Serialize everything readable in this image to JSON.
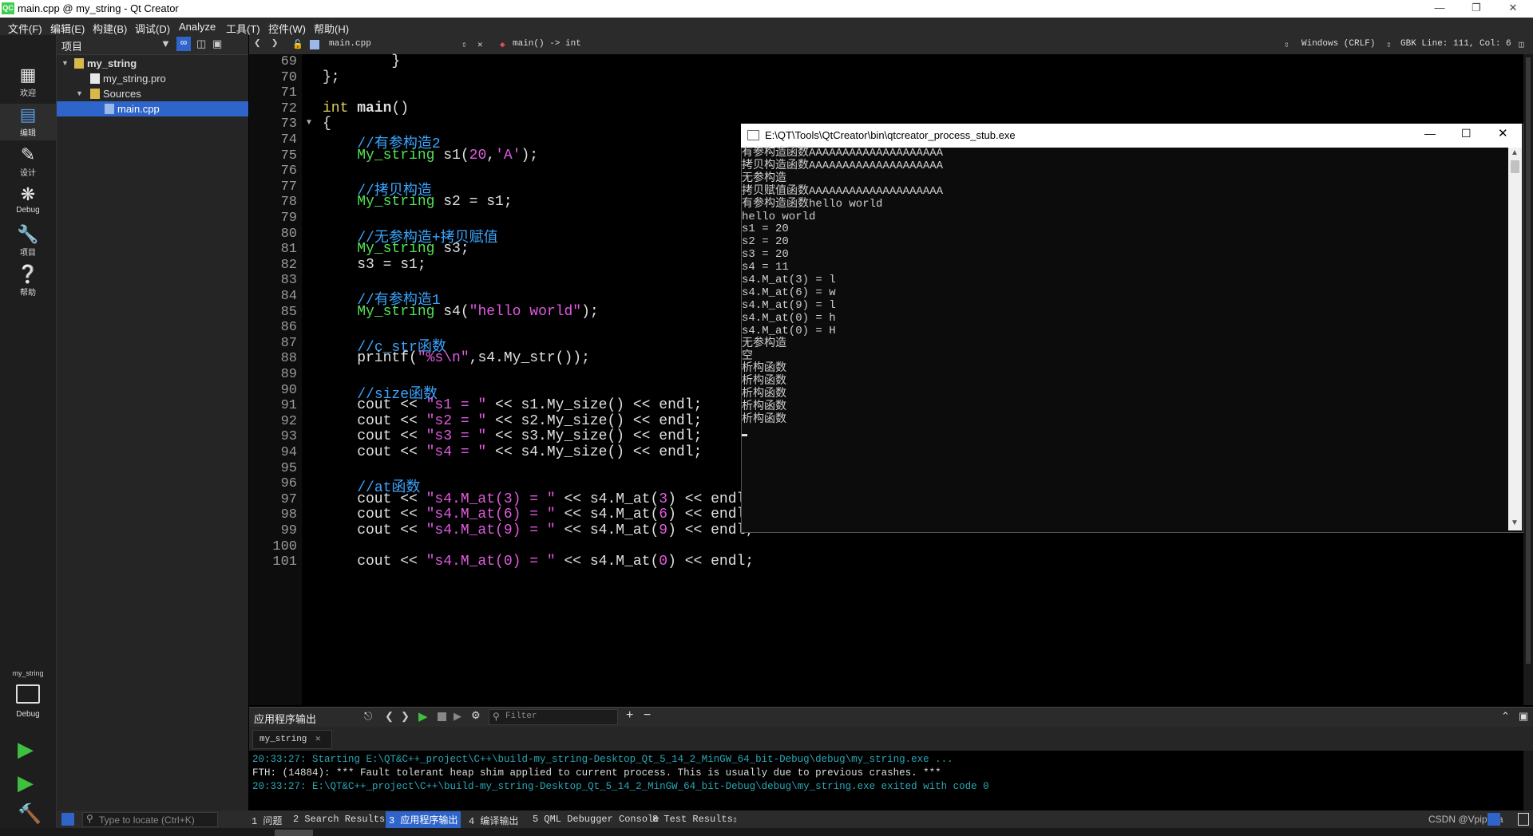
{
  "window": {
    "title": "main.cpp @ my_string - Qt Creator",
    "logo": "QC"
  },
  "menu": [
    "文件(F)",
    "编辑(E)",
    "构建(B)",
    "调试(D)",
    "Analyze",
    "工具(T)",
    "控件(W)",
    "帮助(H)"
  ],
  "modes": [
    {
      "label": "欢迎",
      "icon": "grid-icon"
    },
    {
      "label": "编辑",
      "icon": "edit-icon"
    },
    {
      "label": "设计",
      "icon": "pen-icon"
    },
    {
      "label": "Debug",
      "icon": "bug-icon"
    },
    {
      "label": "项目",
      "icon": "wrench-icon"
    },
    {
      "label": "帮助",
      "icon": "help-icon"
    }
  ],
  "kit": {
    "project": "my_string",
    "config": "Debug"
  },
  "project_panel": {
    "title": "项目",
    "tree": [
      {
        "label": "my_string",
        "level": 0
      },
      {
        "label": "my_string.pro",
        "level": 1
      },
      {
        "label": "Sources",
        "level": 1
      },
      {
        "label": "main.cpp",
        "level": 2
      }
    ]
  },
  "editor_toolbar": {
    "file": "main.cpp",
    "symbol": "main() -> int",
    "line_ending": "Windows (CRLF)",
    "status": "GBK Line: 111, Col: 6"
  },
  "code_lines": [
    {
      "n": "69",
      "t": "        }"
    },
    {
      "n": "70",
      "t": "};"
    },
    {
      "n": "71",
      "t": ""
    },
    {
      "n": "72",
      "t": "int main()"
    },
    {
      "n": "73",
      "t": "{"
    },
    {
      "n": "74",
      "t": "    //有参构造2"
    },
    {
      "n": "75",
      "t": "    My_string s1(20,'A');"
    },
    {
      "n": "76",
      "t": ""
    },
    {
      "n": "77",
      "t": "    //拷贝构造"
    },
    {
      "n": "78",
      "t": "    My_string s2 = s1;"
    },
    {
      "n": "79",
      "t": ""
    },
    {
      "n": "80",
      "t": "    //无参构造+拷贝赋值"
    },
    {
      "n": "81",
      "t": "    My_string s3;"
    },
    {
      "n": "82",
      "t": "    s3 = s1;"
    },
    {
      "n": "83",
      "t": ""
    },
    {
      "n": "84",
      "t": "    //有参构造1"
    },
    {
      "n": "85",
      "t": "    My_string s4(\"hello world\");"
    },
    {
      "n": "86",
      "t": ""
    },
    {
      "n": "87",
      "t": "    //c_str函数"
    },
    {
      "n": "88",
      "t": "    printf(\"%s\\n\",s4.My_str());"
    },
    {
      "n": "89",
      "t": ""
    },
    {
      "n": "90",
      "t": "    //size函数"
    },
    {
      "n": "91",
      "t": "    cout << \"s1 = \" << s1.My_size() << endl;"
    },
    {
      "n": "92",
      "t": "    cout << \"s2 = \" << s2.My_size() << endl;"
    },
    {
      "n": "93",
      "t": "    cout << \"s3 = \" << s3.My_size() << endl;"
    },
    {
      "n": "94",
      "t": "    cout << \"s4 = \" << s4.My_size() << endl;"
    },
    {
      "n": "95",
      "t": ""
    },
    {
      "n": "96",
      "t": "    //at函数"
    },
    {
      "n": "97",
      "t": "    cout << \"s4.M_at(3) = \" << s4.M_at(3) << endl;"
    },
    {
      "n": "98",
      "t": "    cout << \"s4.M_at(6) = \" << s4.M_at(6) << endl;"
    },
    {
      "n": "99",
      "t": "    cout << \"s4.M_at(9) = \" << s4.M_at(9) << endl;"
    },
    {
      "n": "100",
      "t": ""
    },
    {
      "n": "101",
      "t": "    cout << \"s4.M_at(0) = \" << s4.M_at(0) << endl;"
    }
  ],
  "console": {
    "title": "E:\\QT\\Tools\\QtCreator\\bin\\qtcreator_process_stub.exe",
    "lines": [
      "有参构造函数AAAAAAAAAAAAAAAAAAAA",
      "拷贝构造函数AAAAAAAAAAAAAAAAAAAA",
      "无参构造",
      "拷贝赋值函数AAAAAAAAAAAAAAAAAAAA",
      "有参构造函数hello world",
      "hello world",
      "s1 = 20",
      "s2 = 20",
      "s3 = 20",
      "s4 = 11",
      "s4.M_at(3) = l",
      "s4.M_at(6) = w",
      "s4.M_at(9) = l",
      "s4.M_at(0) = h",
      "s4.M_at(0) = H",
      "无参构造",
      "空",
      "析构函数",
      "析构函数",
      "析构函数",
      "析构函数",
      "析构函数"
    ]
  },
  "output_pane": {
    "title": "应用程序输出",
    "filter_placeholder": "Filter",
    "tab": "my_string",
    "lines": [
      {
        "text": "20:33:27: Starting E:\\QT&C++_project\\C++\\build-my_string-Desktop_Qt_5_14_2_MinGW_64_bit-Debug\\debug\\my_string.exe ...",
        "color": "#2aa7b5"
      },
      {
        "text": "FTH: (14884): *** Fault tolerant heap shim applied to current process. This is usually due to previous crashes. ***",
        "color": "#dddddd"
      },
      {
        "text": "20:33:27: E:\\QT&C++_project\\C++\\build-my_string-Desktop_Qt_5_14_2_MinGW_64_bit-Debug\\debug\\my_string.exe exited with code 0",
        "color": "#2aa7b5"
      }
    ]
  },
  "statusbar": {
    "locator_placeholder": "Type to locate (Ctrl+K)",
    "tabs": [
      "1 问题",
      "2 Search Results",
      "3 应用程序输出",
      "4 编译输出",
      "5 QML Debugger Console",
      "8 Test Results"
    ],
    "watermark": "CSDN @Vpiphua"
  },
  "colors": {
    "accent": "#2f65ca",
    "keyword": "#e0d060",
    "type": "#55e055",
    "comment": "#3aa5ff",
    "string": "#e05be0"
  }
}
